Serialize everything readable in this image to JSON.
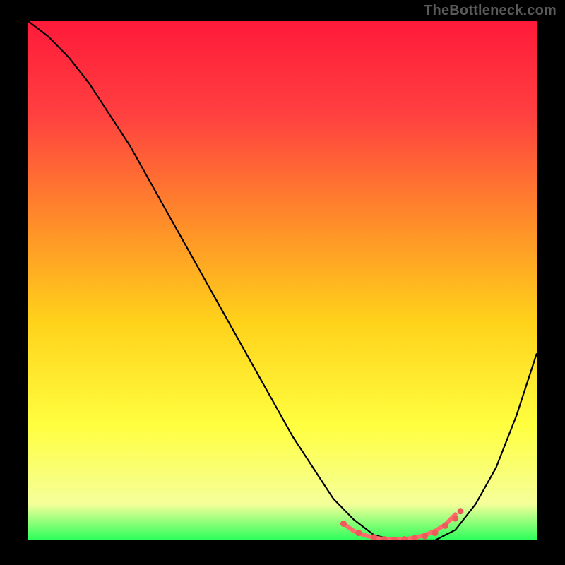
{
  "watermark": "TheBottleneck.com",
  "chart_data": {
    "type": "line",
    "title": "",
    "xlabel": "",
    "ylabel": "",
    "xlim": [
      0,
      100
    ],
    "ylim": [
      0,
      100
    ],
    "gradient_stops": [
      {
        "offset": 0,
        "color": "#ff1a3a"
      },
      {
        "offset": 18,
        "color": "#ff4040"
      },
      {
        "offset": 38,
        "color": "#ff8a2a"
      },
      {
        "offset": 58,
        "color": "#ffd21a"
      },
      {
        "offset": 78,
        "color": "#ffff40"
      },
      {
        "offset": 93,
        "color": "#f5ff9a"
      },
      {
        "offset": 100,
        "color": "#2aff5a"
      }
    ],
    "series": [
      {
        "name": "curve",
        "color": "#000000",
        "x": [
          0,
          4,
          8,
          12,
          16,
          20,
          24,
          28,
          32,
          36,
          40,
          44,
          48,
          52,
          56,
          60,
          64,
          68,
          72,
          76,
          80,
          84,
          88,
          92,
          96,
          100
        ],
        "y": [
          100,
          97,
          93,
          88,
          82,
          76,
          69,
          62,
          55,
          48,
          41,
          34,
          27,
          20,
          14,
          8,
          4,
          1,
          0,
          0,
          0,
          2,
          7,
          14,
          24,
          36
        ]
      },
      {
        "name": "plateau-highlight",
        "color": "#ff6b6b",
        "x": [
          62,
          64,
          66,
          68,
          70,
          72,
          74,
          76,
          78,
          80,
          82,
          84
        ],
        "y": [
          3.2,
          1.8,
          1.0,
          0.5,
          0.2,
          0.1,
          0.2,
          0.5,
          1.0,
          1.8,
          3.0,
          5.0
        ]
      }
    ],
    "markers": {
      "name": "plateau-dots",
      "color": "#ee5a5a",
      "x": [
        62,
        65,
        68,
        70,
        72,
        74,
        76,
        78,
        80,
        82,
        84,
        85
      ],
      "y": [
        3.2,
        1.4,
        0.6,
        0.2,
        0.1,
        0.2,
        0.4,
        0.8,
        1.4,
        2.8,
        4.2,
        5.6
      ]
    }
  }
}
